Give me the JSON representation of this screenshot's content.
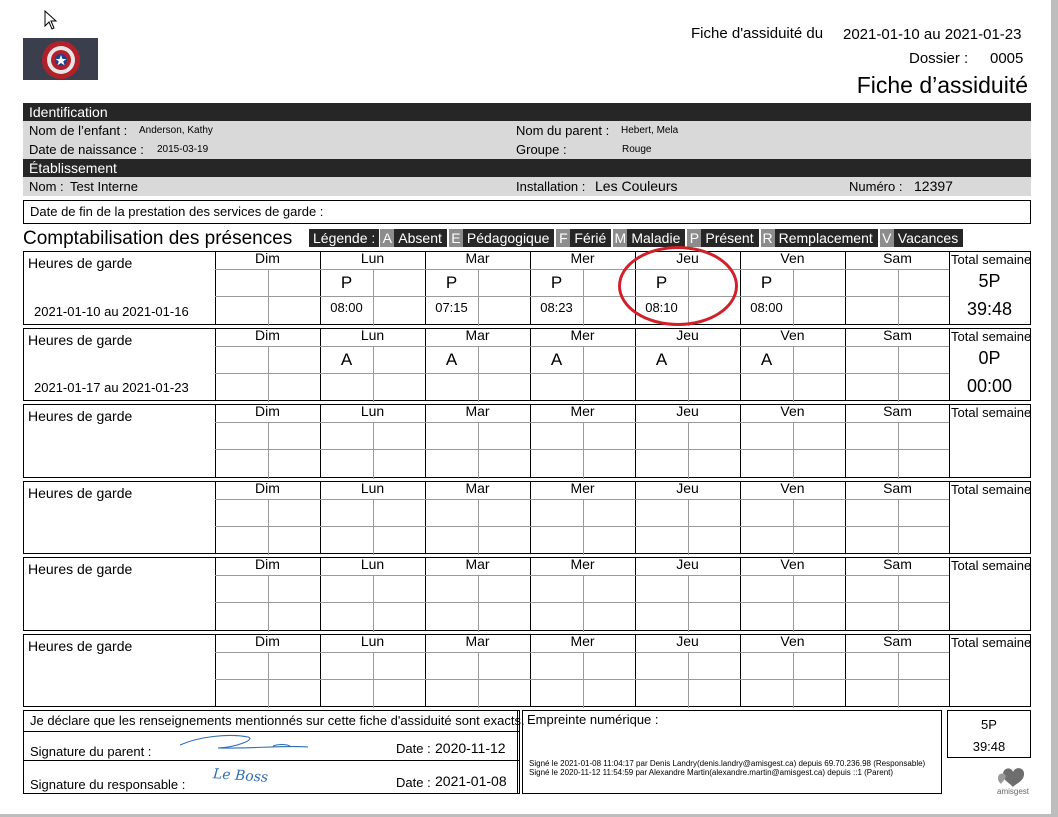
{
  "header": {
    "fiche_label": "Fiche d'assiduité du",
    "period": "2021-01-10 au 2021-01-23",
    "dossier_label": "Dossier :",
    "dossier_value": "0005",
    "title": "Fiche d’assiduité"
  },
  "identification": {
    "section_title": "Identification",
    "child_label": "Nom de l’enfant :",
    "child_value": "Anderson, Kathy",
    "birth_label": "Date de naissance :",
    "birth_value": "2015-03-19",
    "parent_label": "Nom du parent :",
    "parent_value": "Hebert, Mela",
    "group_label": "Groupe :",
    "group_value": "Rouge"
  },
  "etablissement": {
    "section_title": "Établissement",
    "name_label": "Nom :",
    "name_value": "Test Interne",
    "install_label": "Installation :",
    "install_value": "Les Couleurs",
    "numero_label": "Numéro :",
    "numero_value": "12397"
  },
  "date_fin_label": "Date de fin de la prestation des services de garde :",
  "compta_title": "Comptabilisation des présences",
  "legend": {
    "label": "Légende :",
    "items": [
      {
        "code": "A",
        "label": "Absent"
      },
      {
        "code": "E",
        "label": "Pédagogique"
      },
      {
        "code": "F",
        "label": "Férié"
      },
      {
        "code": "M",
        "label": "Maladie"
      },
      {
        "code": "P",
        "label": "Présent"
      },
      {
        "code": "R",
        "label": "Remplacement"
      },
      {
        "code": "V",
        "label": "Vacances"
      }
    ]
  },
  "days": [
    "Dim",
    "Lun",
    "Mar",
    "Mer",
    "Jeu",
    "Ven",
    "Sam"
  ],
  "hours_label": "Heures de garde",
  "total_label": "Total semaine",
  "weeks": [
    {
      "range": "2021-01-10 au 2021-01-16",
      "marks": [
        "",
        "P",
        "P",
        "P",
        "P",
        "P",
        ""
      ],
      "times": [
        "",
        "08:00",
        "07:15",
        "08:23",
        "08:10",
        "08:00",
        ""
      ],
      "total_p": "5P",
      "total_h": "39:48"
    },
    {
      "range": "2021-01-17 au 2021-01-23",
      "marks": [
        "",
        "A",
        "A",
        "A",
        "A",
        "A",
        ""
      ],
      "times": [
        "",
        "",
        "",
        "",
        "",
        "",
        ""
      ],
      "total_p": "0P",
      "total_h": "00:00"
    },
    {
      "range": "",
      "marks": [
        "",
        "",
        "",
        "",
        "",
        "",
        ""
      ],
      "times": [
        "",
        "",
        "",
        "",
        "",
        "",
        ""
      ],
      "total_p": "",
      "total_h": ""
    },
    {
      "range": "",
      "marks": [
        "",
        "",
        "",
        "",
        "",
        "",
        ""
      ],
      "times": [
        "",
        "",
        "",
        "",
        "",
        "",
        ""
      ],
      "total_p": "",
      "total_h": ""
    },
    {
      "range": "",
      "marks": [
        "",
        "",
        "",
        "",
        "",
        "",
        ""
      ],
      "times": [
        "",
        "",
        "",
        "",
        "",
        "",
        ""
      ],
      "total_p": "",
      "total_h": ""
    },
    {
      "range": "",
      "marks": [
        "",
        "",
        "",
        "",
        "",
        "",
        ""
      ],
      "times": [
        "",
        "",
        "",
        "",
        "",
        "",
        ""
      ],
      "total_p": "",
      "total_h": ""
    }
  ],
  "declaration": {
    "text": "Je déclare que les renseignements mentionnés sur cette fiche d'assiduité sont exacts.",
    "parent_sig_label": "Signature du parent :",
    "parent_date_label": "Date :",
    "parent_date": "2020-11-12",
    "resp_sig_label": "Signature du responsable :",
    "resp_signature": "Le Boss",
    "resp_date_label": "Date :",
    "resp_date": "2021-01-08"
  },
  "empreinte": {
    "label": "Empreinte numérique :",
    "lines": [
      "Signé le 2021-01-08 11:04:17 par Denis Landry(denis.landry@amisgest.ca) depuis 69.70.236.98 (Responsable)",
      "Signé le 2020-11-12 11:54:59 par Alexandre Martin(alexandre.martin@amisgest.ca) depuis ::1 (Parent)"
    ]
  },
  "grand_total": {
    "p": "5P",
    "h": "39:48"
  },
  "brand": "amisgest",
  "colors": {
    "dark": "#262626",
    "light": "#d9d9d9",
    "code": "#8c8c8c",
    "annotation": "#d0202a",
    "signature": "#2f6db5"
  }
}
